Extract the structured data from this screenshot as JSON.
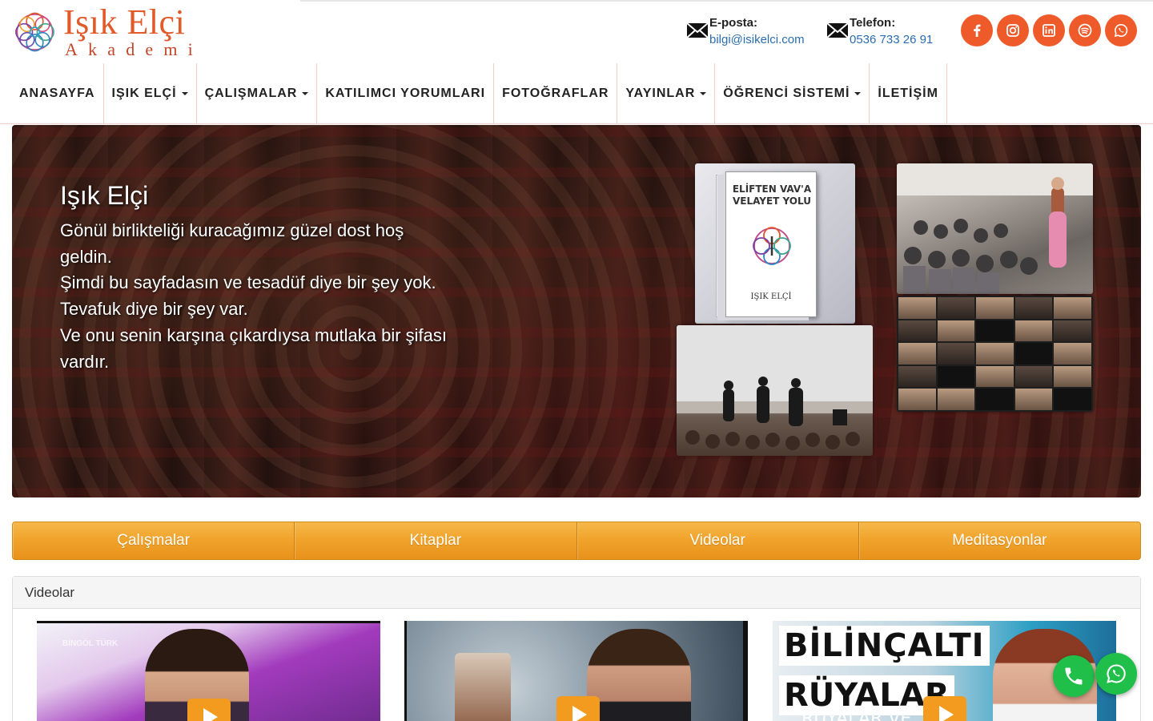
{
  "brand": {
    "name": "Işık Elçi",
    "subtitle": "Akademi",
    "primary_color": "#ef5a2a",
    "accent_orange": "#f0a22a"
  },
  "contact": {
    "email_label": "E-posta:",
    "email_value": "bilgi@isikelci.com",
    "phone_label": "Telefon:",
    "phone_value": "0536 733 26 91"
  },
  "socials": [
    {
      "name": "facebook-icon"
    },
    {
      "name": "instagram-icon"
    },
    {
      "name": "linkedin-icon"
    },
    {
      "name": "spotify-icon"
    },
    {
      "name": "whatsapp-icon"
    }
  ],
  "nav": {
    "items": [
      {
        "label": "ANASAYFA",
        "dropdown": false
      },
      {
        "label": "IŞIK ELÇİ",
        "dropdown": true
      },
      {
        "label": "ÇALIŞMALAR",
        "dropdown": true
      },
      {
        "label": "KATILIMCI YORUMLARI",
        "dropdown": false
      },
      {
        "label": "FOTOĞRAFLAR",
        "dropdown": false
      },
      {
        "label": "YAYINLAR",
        "dropdown": true
      },
      {
        "label": "ÖĞRENCİ SİSTEMİ",
        "dropdown": true
      },
      {
        "label": "İLETİŞİM",
        "dropdown": false
      }
    ]
  },
  "hero": {
    "title": "Işık Elçi",
    "lines": [
      "Gönül birlikteliği kuracağımız güzel dost hoş",
      "geldin.",
      "Şimdi bu sayfadasın ve tesadüf diye bir şey yok.",
      "Tevafuk diye bir şey var.",
      "Ve onu senin karşına çıkardıysa mutlaka bir şifası",
      "vardır."
    ],
    "book_title_line1": "ELİFTEN VAV'A",
    "book_title_line2": "VELAYET YOLU",
    "book_author": "IŞIK ELÇİ"
  },
  "tabs": [
    {
      "label": "Çalışmalar"
    },
    {
      "label": "Kitaplar"
    },
    {
      "label": "Videolar"
    },
    {
      "label": "Meditasyonlar"
    }
  ],
  "videos_panel": {
    "title": "Videolar",
    "videos": [
      {
        "overlay_text": "BİNGÖL TÜRK"
      },
      {
        "overlay_text": ""
      },
      {
        "overlay_line1": "BİLİNÇALTI",
        "overlay_line2": "RÜYALAR",
        "overlay_sub": "RÜYALAR VE"
      }
    ]
  },
  "floating": {
    "phone_color": "#1fbf4a",
    "whatsapp_color": "#1fbf4a"
  }
}
